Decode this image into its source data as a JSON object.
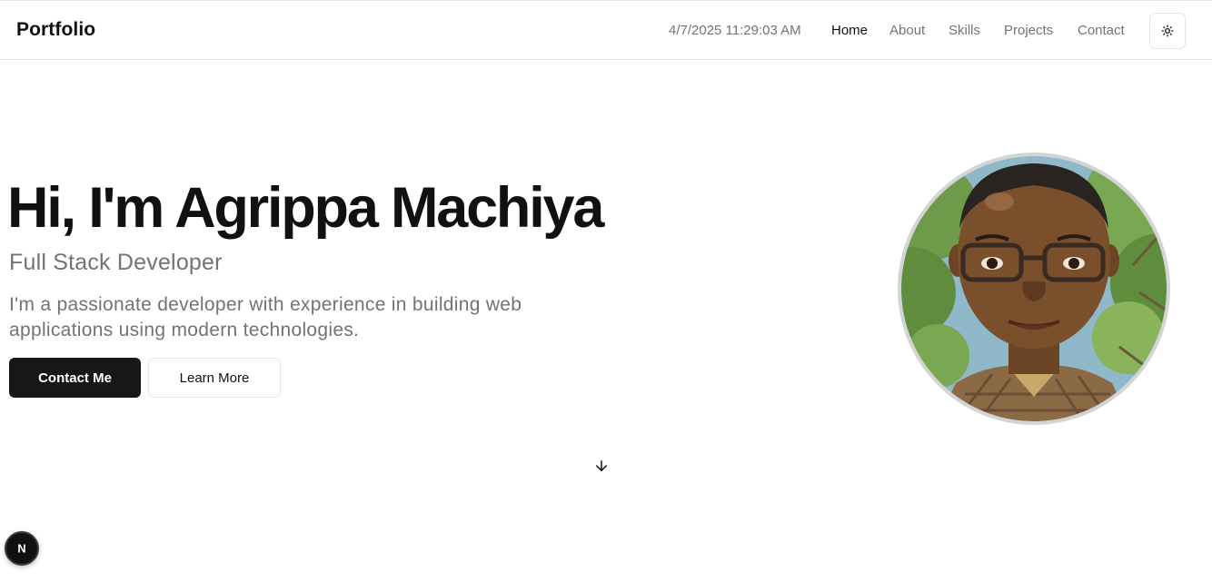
{
  "header": {
    "brand": "Portfolio",
    "datetime": "4/7/2025 11:29:03 AM",
    "nav": {
      "home": "Home",
      "about": "About",
      "skills": "Skills",
      "projects": "Projects",
      "contact": "Contact"
    },
    "active_nav": "Home",
    "theme_toggle_icon": "sun-icon"
  },
  "hero": {
    "title": "Hi, I'm Agrippa Machiya",
    "role": "Full Stack Developer",
    "description": "I'm a passionate developer with experience in building web applications using modern technologies.",
    "primary_button": "Contact Me",
    "secondary_button": "Learn More",
    "profile_image_icon": "profile-portrait-illustration",
    "scroll_icon": "arrow-down-icon"
  },
  "dev_badge": {
    "icon": "nextjs-logo-icon",
    "glyph": "N"
  },
  "colors": {
    "text_primary": "#111111",
    "text_muted": "#737373",
    "button_dark": "#171717",
    "border": "#e5e5e5",
    "avatar_ring": "#d4d4d4"
  }
}
